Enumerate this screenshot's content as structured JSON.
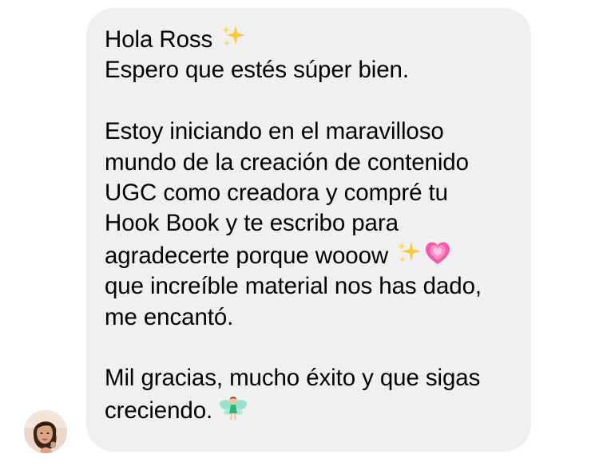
{
  "message": {
    "sender_avatar_icon": "avatar-woman-photo",
    "lines": [
      "Hola Ross",
      "Espero que estés súper bien.",
      "",
      "Estoy iniciando en el maravilloso",
      "mundo de la creación de contenido",
      "UGC como creadora y compré tu",
      "Hook Book y te escribo para",
      "agradecerte porque wooow",
      "que increíble material nos has dado,",
      "me encantó.",
      "",
      "Mil gracias, mucho éxito y que sigas",
      "creciendo."
    ],
    "emojis": {
      "greeting": "sparkles-emoji",
      "wooow_1": "sparkles-emoji",
      "wooow_2": "growing-heart-emoji",
      "closing": "fairy-emoji"
    }
  },
  "colors": {
    "bubble_background": "#f0f0f3",
    "text": "#000000",
    "heart": "#f25aa6",
    "sparkle": "#ffcc33"
  }
}
